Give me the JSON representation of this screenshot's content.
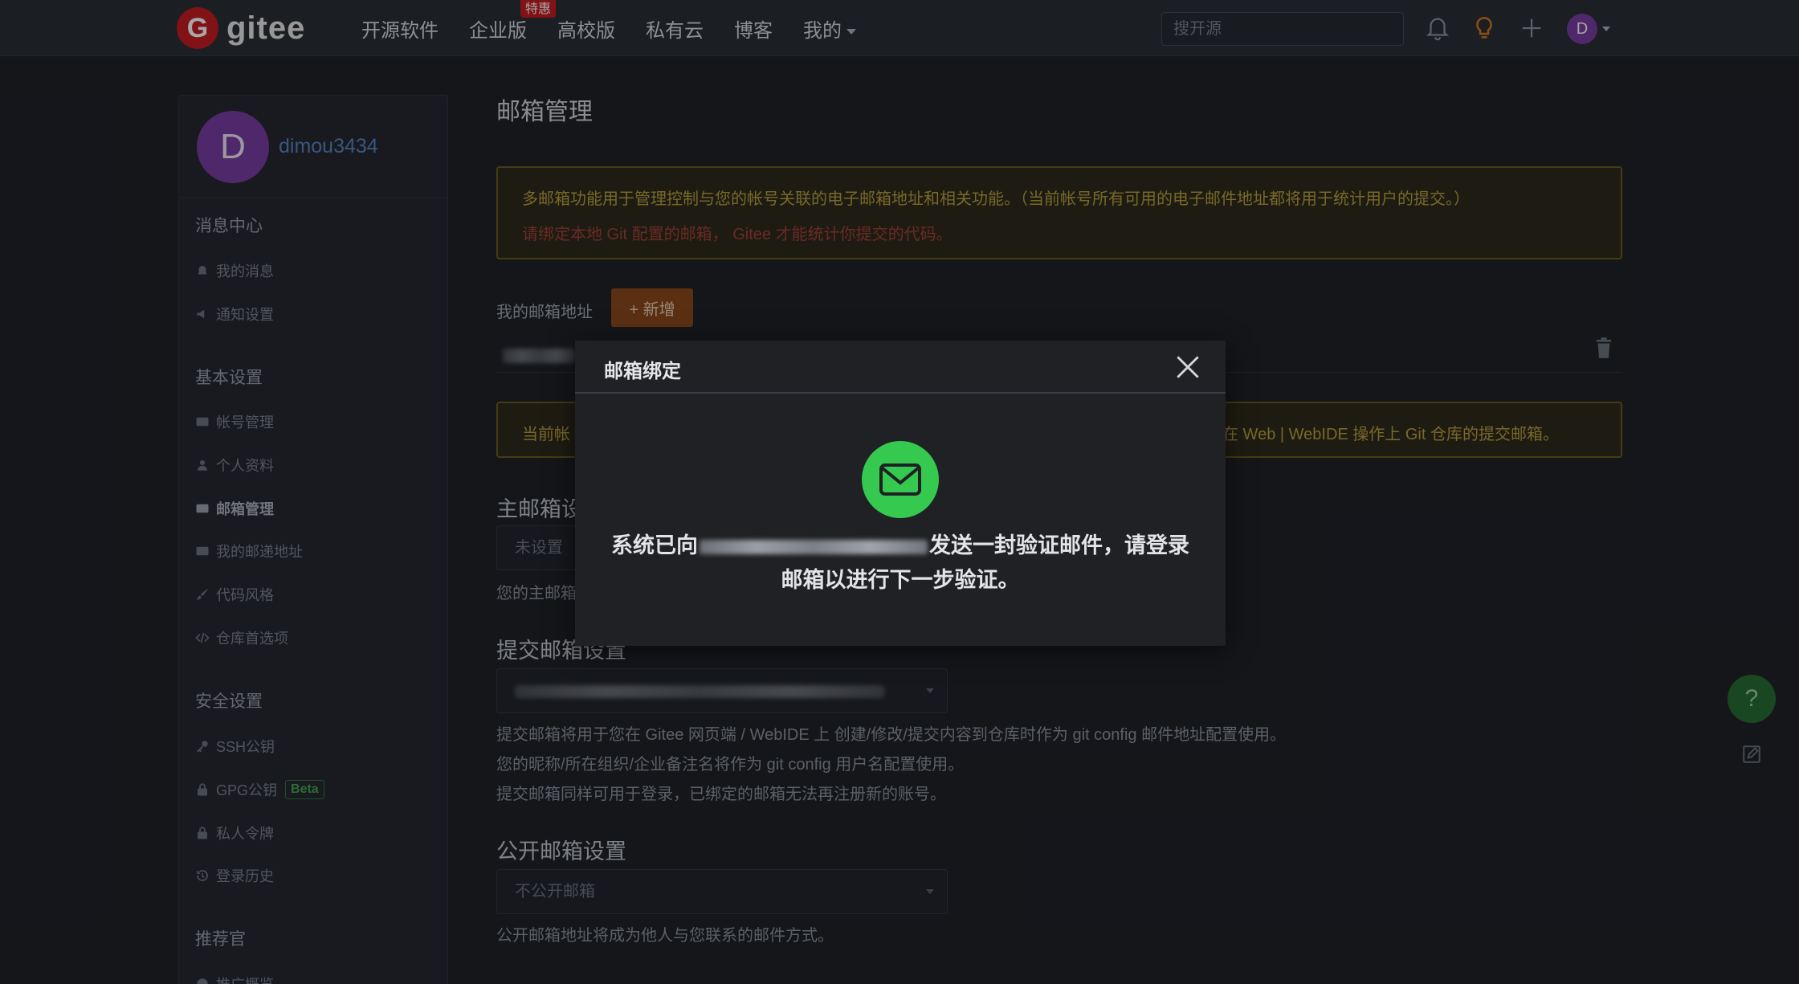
{
  "nav": {
    "logo_mark": "G",
    "logo_text": "gitee",
    "items": [
      {
        "label": "开源软件"
      },
      {
        "label": "企业版",
        "badge": "特惠"
      },
      {
        "label": "高校版"
      },
      {
        "label": "私有云"
      },
      {
        "label": "博客"
      },
      {
        "label": "我的"
      }
    ],
    "search_placeholder": "搜开源",
    "avatar_letter": "D"
  },
  "sidebar": {
    "avatar_letter": "D",
    "username": "dimou3434",
    "sections": [
      {
        "title": "消息中心",
        "items": [
          "我的消息",
          "通知设置"
        ]
      },
      {
        "title": "基本设置",
        "items": [
          "帐号管理",
          "个人资料",
          "邮箱管理",
          "我的邮递地址",
          "代码风格",
          "仓库首选项"
        ]
      },
      {
        "title": "安全设置",
        "items": [
          "SSH公钥",
          "GPG公钥",
          "私人令牌",
          "登录历史"
        ]
      },
      {
        "title": "推荐官",
        "items": [
          "推广概览"
        ]
      }
    ],
    "beta_label": "Beta",
    "active_item": "邮箱管理"
  },
  "main": {
    "title": "邮箱管理",
    "info_line1": "多邮箱功能用于管理控制与您的帐号关联的电子邮箱地址和相关功能。（当前帐号所有可用的电子邮件地址都将用于统计用户的提交。）",
    "info_line2": "请绑定本地 Git 配置的邮箱， Gitee 才能统计你提交的代码。",
    "my_emails_label": "我的邮箱地址",
    "add_button": "+ 新增",
    "warn2_left": "当前帐",
    "warn2_right": "在 Web | WebIDE 操作上 Git 仓库的提交邮箱。",
    "primary_title": "主邮箱设",
    "primary_input": "未设置",
    "primary_note": "您的主邮箱",
    "commit_title": "提交邮箱设置",
    "commit_notes": [
      "提交邮箱将用于您在 Gitee 网页端 / WebIDE 上 创建/修改/提交内容到仓库时作为 git config 邮件地址配置使用。",
      "您的昵称/所在组织/企业备注名将作为 git config 用户名配置使用。",
      "提交邮箱同样可用于登录，已绑定的邮箱无法再注册新的账号。"
    ],
    "public_title": "公开邮箱设置",
    "public_select": "不公开邮箱",
    "public_note": "公开邮箱地址将成为他人与您联系的邮件方式。",
    "help_label": "?"
  },
  "modal": {
    "title": "邮箱绑定",
    "text_before": "系统已向",
    "text_after": "发送一封验证邮件，请登录",
    "text_line2": "邮箱以进行下一步验证。"
  },
  "colors": {
    "accent_green": "#36c950",
    "brand_red": "#c71d23",
    "add_button": "#8d4a1c",
    "avatar": "#7a3ea6"
  }
}
